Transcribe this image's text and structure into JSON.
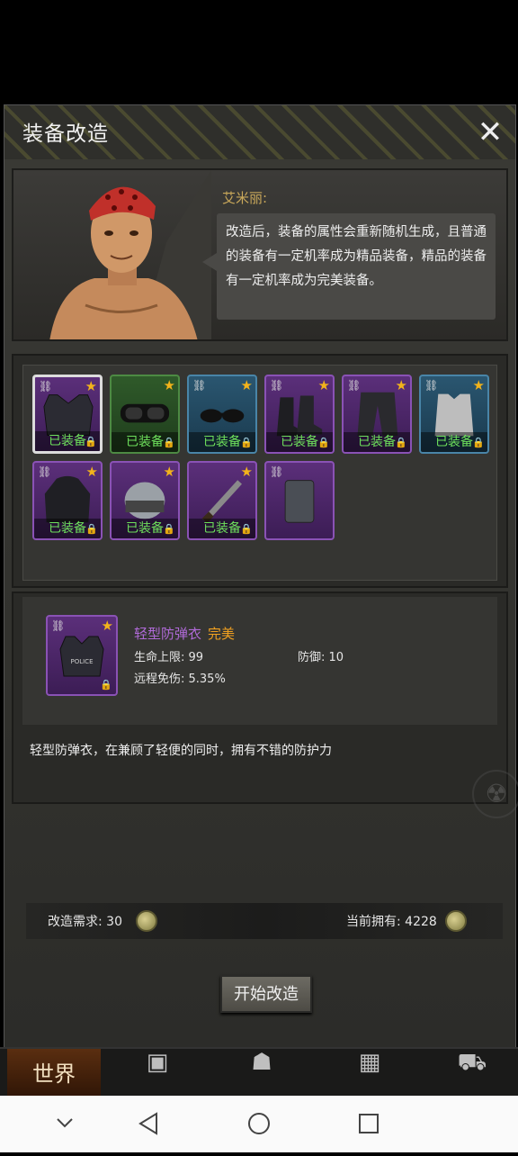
{
  "dialog": {
    "title": "装备改造",
    "close_icon": "close-icon"
  },
  "npc": {
    "name": "艾米丽:",
    "speech": "改造后，装备的属性会重新随机生成，且普通的装备有一定机率成为精品装备，精品的装备有一定机率成为完美装备。"
  },
  "equipment": {
    "equipped_label": "已装备",
    "slots": [
      {
        "item": "light-body-armor",
        "rarity": "purple",
        "selected": true,
        "equipped": true,
        "locked": true,
        "starred": true,
        "linked": true
      },
      {
        "item": "goggles",
        "rarity": "green",
        "selected": false,
        "equipped": true,
        "locked": true,
        "starred": true,
        "linked": false
      },
      {
        "item": "sunglasses",
        "rarity": "blue",
        "selected": false,
        "equipped": true,
        "locked": true,
        "starred": true,
        "linked": true
      },
      {
        "item": "combat-boots",
        "rarity": "purple",
        "selected": false,
        "equipped": true,
        "locked": true,
        "starred": true,
        "linked": true
      },
      {
        "item": "cargo-pants",
        "rarity": "purple",
        "selected": false,
        "equipped": true,
        "locked": true,
        "starred": true,
        "linked": true
      },
      {
        "item": "undershirt",
        "rarity": "blue",
        "selected": false,
        "equipped": true,
        "locked": true,
        "starred": true,
        "linked": true
      },
      {
        "item": "hooded-jacket",
        "rarity": "purple",
        "selected": false,
        "equipped": true,
        "locked": true,
        "starred": true,
        "linked": true
      },
      {
        "item": "riot-helmet",
        "rarity": "purple",
        "selected": false,
        "equipped": true,
        "locked": true,
        "starred": true,
        "linked": false
      },
      {
        "item": "machete",
        "rarity": "purple",
        "selected": false,
        "equipped": true,
        "locked": true,
        "starred": true,
        "linked": false
      },
      {
        "item": "riot-shield",
        "rarity": "purple",
        "selected": false,
        "equipped": false,
        "locked": false,
        "starred": false,
        "linked": true
      }
    ]
  },
  "detail": {
    "name": "轻型防弹衣",
    "quality": "完美",
    "stats": {
      "hp": "生命上限: 99",
      "defense": "防御: 10",
      "ranged": "远程免伤: 5.35%"
    },
    "description": "轻型防弹衣，在兼顾了轻便的同时，拥有不错的防护力",
    "vest_label": "POLICE"
  },
  "cost": {
    "need_label": "改造需求: 30",
    "have_label": "当前拥有: 4228"
  },
  "start_button": "开始改造",
  "game_nav": {
    "world": "世界"
  },
  "colors": {
    "purple": "#8a52b5",
    "green": "#4d8a43",
    "blue": "#4985a8",
    "equipped_text": "#6ee05c",
    "quality_text": "#f0a020",
    "item_name": "#b06ad8"
  }
}
